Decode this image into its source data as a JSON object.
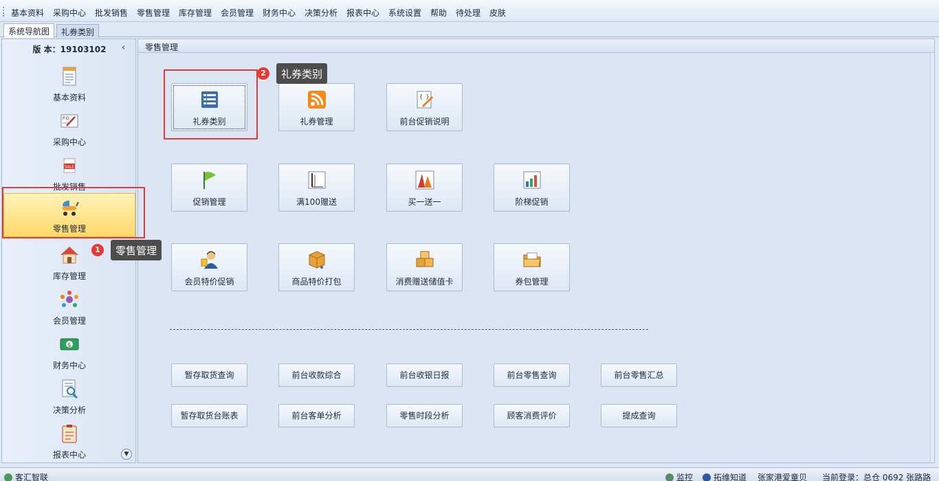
{
  "menu": [
    "基本资料",
    "采购中心",
    "批发销售",
    "零售管理",
    "库存管理",
    "会员管理",
    "财务中心",
    "决策分析",
    "报表中心",
    "系统设置",
    "帮助",
    "待处理",
    "皮肤"
  ],
  "tabs": [
    "系统导航图",
    "礼券类别"
  ],
  "sidebar": {
    "version": "版 本：19103102",
    "items": [
      {
        "label": "基本资料",
        "icon": "document-icon"
      },
      {
        "label": "采购中心",
        "icon": "purchase-order-icon"
      },
      {
        "label": "批发销售",
        "icon": "sale-tag-icon"
      },
      {
        "label": "零售管理",
        "icon": "stroller-icon"
      },
      {
        "label": "库存管理",
        "icon": "house-icon"
      },
      {
        "label": "会员管理",
        "icon": "members-icon"
      },
      {
        "label": "财务中心",
        "icon": "money-icon"
      },
      {
        "label": "决策分析",
        "icon": "analysis-icon"
      },
      {
        "label": "报表中心",
        "icon": "report-icon"
      }
    ]
  },
  "panel": {
    "title": "零售管理",
    "tiles": [
      {
        "label": "礼券类别",
        "icon": "list-icon"
      },
      {
        "label": "礼券管理",
        "icon": "rss-icon"
      },
      {
        "label": "前台促销说明",
        "icon": "edit-code-icon"
      },
      {
        "label": "促销管理",
        "icon": "flag-icon"
      },
      {
        "label": "满100赠送",
        "icon": "ruler-icon"
      },
      {
        "label": "买一送一",
        "icon": "peaks-icon"
      },
      {
        "label": "阶梯促销",
        "icon": "bar-chart-icon"
      },
      {
        "label": "会员特价促销",
        "icon": "member-icon"
      },
      {
        "label": "商品特价打包",
        "icon": "box-cart-icon"
      },
      {
        "label": "消费赠送储值卡",
        "icon": "boxes-icon"
      },
      {
        "label": "券包管理",
        "icon": "folder-icon"
      }
    ],
    "reports_row1": [
      "暂存取货查询",
      "前台收款综合",
      "前台收银日报",
      "前台零售查询",
      "前台零售汇总"
    ],
    "reports_row2": [
      "暂存取货台账表",
      "前台客单分析",
      "零售时段分析",
      "顾客消费评价",
      "提成查询"
    ]
  },
  "annotations": [
    {
      "number": "1",
      "text": "零售管理"
    },
    {
      "number": "2",
      "text": "礼券类别"
    }
  ],
  "statusbar": {
    "left": "客汇智联",
    "monitor": "监控",
    "notice": "拓维知道",
    "store": "张家港爱童贝",
    "login": "当前登录：总仓 0692 张路路"
  },
  "colors": {
    "highlight": "#e53935",
    "active_nav": "#ffd96a",
    "callout": "#4d4d4d"
  }
}
